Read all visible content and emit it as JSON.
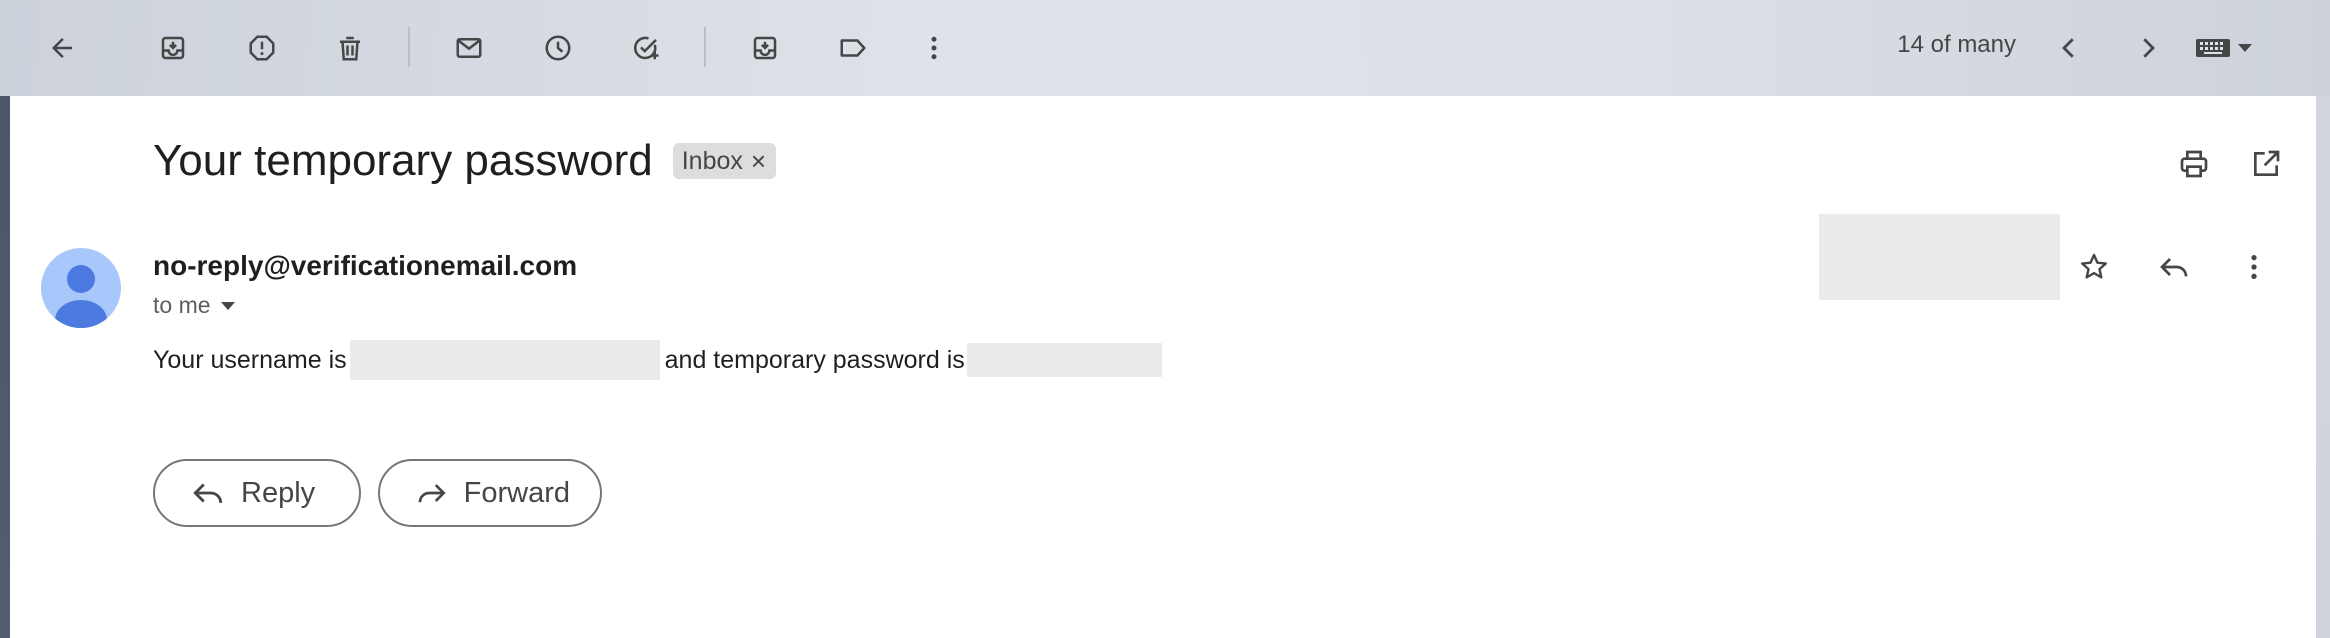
{
  "toolbar": {
    "icons": [
      "back-arrow-icon",
      "archive-icon",
      "report-spam-icon",
      "delete-icon",
      "mark-unread-icon",
      "snooze-icon",
      "add-task-icon",
      "move-to-icon",
      "label-icon",
      "more-vert-icon"
    ],
    "pager_text": "14 of many"
  },
  "email": {
    "subject": "Your temporary password",
    "label": "Inbox",
    "label_close": "×",
    "sender": "no-reply@verificationemail.com",
    "recipient": "to me",
    "body_part1": "Your username is",
    "body_part2": "and temporary password is"
  },
  "actions": {
    "reply_label": "Reply",
    "forward_label": "Forward"
  },
  "colors": {
    "avatar_bg": "#a8c7fa",
    "avatar_fg": "#4c7ae0",
    "icon": "#444746"
  }
}
